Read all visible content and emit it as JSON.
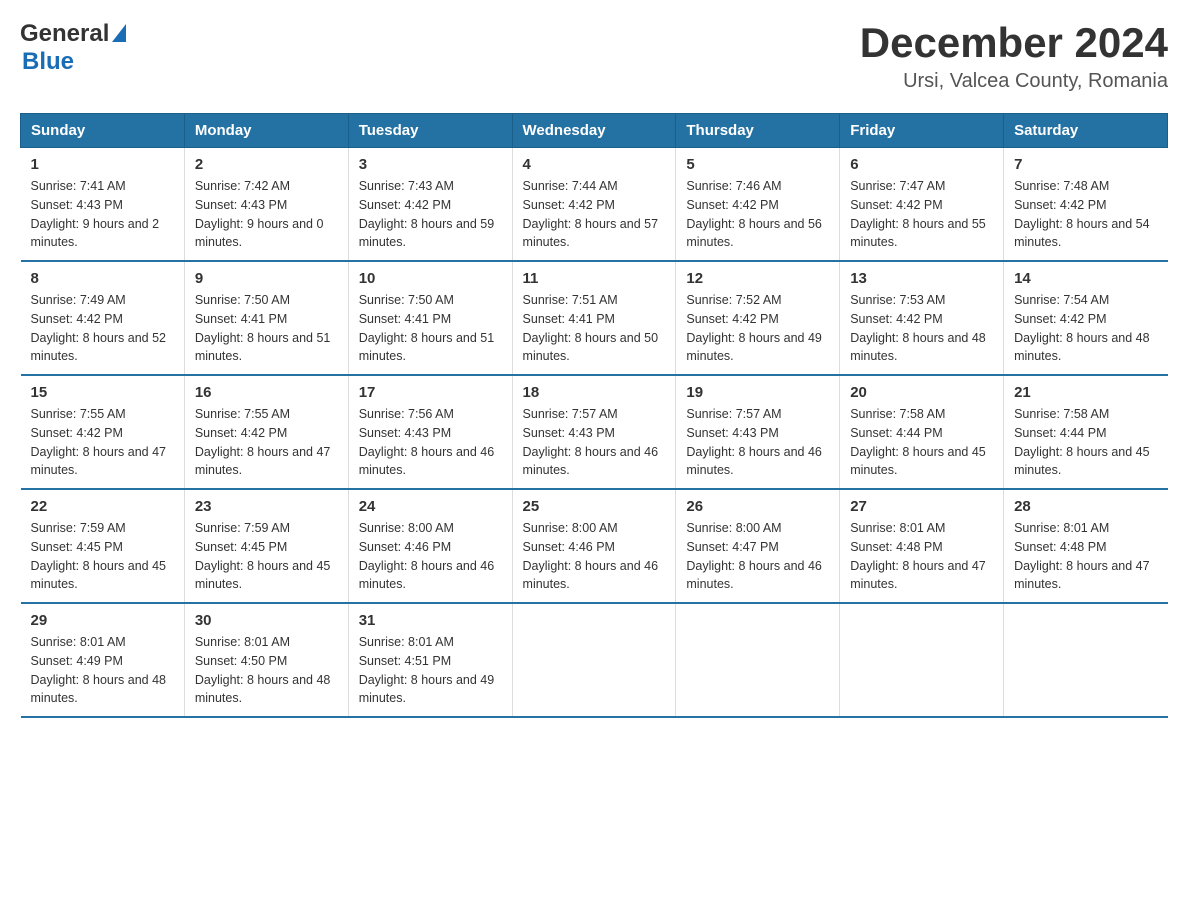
{
  "header": {
    "logo_general": "General",
    "logo_blue": "Blue",
    "month_title": "December 2024",
    "location": "Ursi, Valcea County, Romania"
  },
  "days_of_week": [
    "Sunday",
    "Monday",
    "Tuesday",
    "Wednesday",
    "Thursday",
    "Friday",
    "Saturday"
  ],
  "weeks": [
    [
      {
        "day": "1",
        "sunrise": "7:41 AM",
        "sunset": "4:43 PM",
        "daylight": "9 hours and 2 minutes."
      },
      {
        "day": "2",
        "sunrise": "7:42 AM",
        "sunset": "4:43 PM",
        "daylight": "9 hours and 0 minutes."
      },
      {
        "day": "3",
        "sunrise": "7:43 AM",
        "sunset": "4:42 PM",
        "daylight": "8 hours and 59 minutes."
      },
      {
        "day": "4",
        "sunrise": "7:44 AM",
        "sunset": "4:42 PM",
        "daylight": "8 hours and 57 minutes."
      },
      {
        "day": "5",
        "sunrise": "7:46 AM",
        "sunset": "4:42 PM",
        "daylight": "8 hours and 56 minutes."
      },
      {
        "day": "6",
        "sunrise": "7:47 AM",
        "sunset": "4:42 PM",
        "daylight": "8 hours and 55 minutes."
      },
      {
        "day": "7",
        "sunrise": "7:48 AM",
        "sunset": "4:42 PM",
        "daylight": "8 hours and 54 minutes."
      }
    ],
    [
      {
        "day": "8",
        "sunrise": "7:49 AM",
        "sunset": "4:42 PM",
        "daylight": "8 hours and 52 minutes."
      },
      {
        "day": "9",
        "sunrise": "7:50 AM",
        "sunset": "4:41 PM",
        "daylight": "8 hours and 51 minutes."
      },
      {
        "day": "10",
        "sunrise": "7:50 AM",
        "sunset": "4:41 PM",
        "daylight": "8 hours and 51 minutes."
      },
      {
        "day": "11",
        "sunrise": "7:51 AM",
        "sunset": "4:41 PM",
        "daylight": "8 hours and 50 minutes."
      },
      {
        "day": "12",
        "sunrise": "7:52 AM",
        "sunset": "4:42 PM",
        "daylight": "8 hours and 49 minutes."
      },
      {
        "day": "13",
        "sunrise": "7:53 AM",
        "sunset": "4:42 PM",
        "daylight": "8 hours and 48 minutes."
      },
      {
        "day": "14",
        "sunrise": "7:54 AM",
        "sunset": "4:42 PM",
        "daylight": "8 hours and 48 minutes."
      }
    ],
    [
      {
        "day": "15",
        "sunrise": "7:55 AM",
        "sunset": "4:42 PM",
        "daylight": "8 hours and 47 minutes."
      },
      {
        "day": "16",
        "sunrise": "7:55 AM",
        "sunset": "4:42 PM",
        "daylight": "8 hours and 47 minutes."
      },
      {
        "day": "17",
        "sunrise": "7:56 AM",
        "sunset": "4:43 PM",
        "daylight": "8 hours and 46 minutes."
      },
      {
        "day": "18",
        "sunrise": "7:57 AM",
        "sunset": "4:43 PM",
        "daylight": "8 hours and 46 minutes."
      },
      {
        "day": "19",
        "sunrise": "7:57 AM",
        "sunset": "4:43 PM",
        "daylight": "8 hours and 46 minutes."
      },
      {
        "day": "20",
        "sunrise": "7:58 AM",
        "sunset": "4:44 PM",
        "daylight": "8 hours and 45 minutes."
      },
      {
        "day": "21",
        "sunrise": "7:58 AM",
        "sunset": "4:44 PM",
        "daylight": "8 hours and 45 minutes."
      }
    ],
    [
      {
        "day": "22",
        "sunrise": "7:59 AM",
        "sunset": "4:45 PM",
        "daylight": "8 hours and 45 minutes."
      },
      {
        "day": "23",
        "sunrise": "7:59 AM",
        "sunset": "4:45 PM",
        "daylight": "8 hours and 45 minutes."
      },
      {
        "day": "24",
        "sunrise": "8:00 AM",
        "sunset": "4:46 PM",
        "daylight": "8 hours and 46 minutes."
      },
      {
        "day": "25",
        "sunrise": "8:00 AM",
        "sunset": "4:46 PM",
        "daylight": "8 hours and 46 minutes."
      },
      {
        "day": "26",
        "sunrise": "8:00 AM",
        "sunset": "4:47 PM",
        "daylight": "8 hours and 46 minutes."
      },
      {
        "day": "27",
        "sunrise": "8:01 AM",
        "sunset": "4:48 PM",
        "daylight": "8 hours and 47 minutes."
      },
      {
        "day": "28",
        "sunrise": "8:01 AM",
        "sunset": "4:48 PM",
        "daylight": "8 hours and 47 minutes."
      }
    ],
    [
      {
        "day": "29",
        "sunrise": "8:01 AM",
        "sunset": "4:49 PM",
        "daylight": "8 hours and 48 minutes."
      },
      {
        "day": "30",
        "sunrise": "8:01 AM",
        "sunset": "4:50 PM",
        "daylight": "8 hours and 48 minutes."
      },
      {
        "day": "31",
        "sunrise": "8:01 AM",
        "sunset": "4:51 PM",
        "daylight": "8 hours and 49 minutes."
      },
      null,
      null,
      null,
      null
    ]
  ],
  "labels": {
    "sunrise_prefix": "Sunrise: ",
    "sunset_prefix": "Sunset: ",
    "daylight_prefix": "Daylight: "
  }
}
